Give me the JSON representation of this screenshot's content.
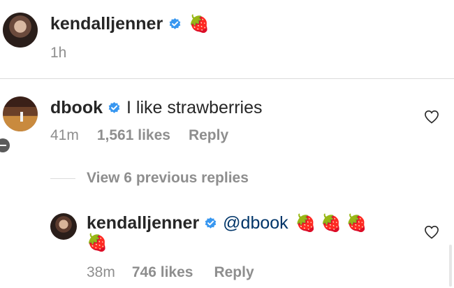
{
  "post": {
    "username": "kendalljenner",
    "caption_emoji": "🍓",
    "time": "1h"
  },
  "comment": {
    "username": "dbook",
    "text": "I like strawberries",
    "time": "41m",
    "likes": "1,561 likes",
    "reply_label": "Reply"
  },
  "view_replies": "View 6 previous replies",
  "reply": {
    "username": "kendalljenner",
    "mention": "@dbook",
    "emoji_line1": "🍓 🍓 🍓",
    "emoji_line2": "🍓",
    "time": "38m",
    "likes": "746 likes",
    "reply_label": "Reply"
  },
  "colors": {
    "verified": "#3897f0",
    "mention": "#003569",
    "muted": "#8e8e8e"
  },
  "icons": [
    "verified-icon",
    "heart-icon",
    "collapse-icon"
  ]
}
